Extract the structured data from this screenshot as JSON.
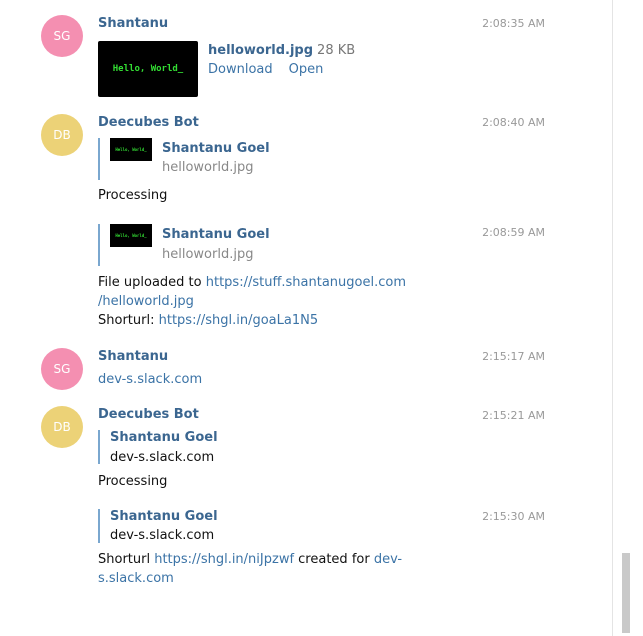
{
  "messages": {
    "m1": {
      "avatar": "SG",
      "author": "Shantanu",
      "time": "2:08:35 AM",
      "file": {
        "thumb_text": "Hello, World_",
        "name": "helloworld.jpg",
        "size": "28 KB",
        "download": "Download",
        "open": "Open"
      }
    },
    "m2": {
      "avatar": "DB",
      "author": "Deecubes Bot",
      "time": "2:08:40 AM",
      "quote": {
        "thumb_text": "Hello, World_",
        "title": "Shantanu Goel",
        "subtitle": "helloworld.jpg"
      },
      "text": "Processing"
    },
    "m3": {
      "time": "2:08:59 AM",
      "quote": {
        "thumb_text": "Hello, World_",
        "title": "Shantanu Goel",
        "subtitle": "helloworld.jpg"
      },
      "line1_prefix": "File uploaded to ",
      "line1_link": "https://stuff.shantanugoel.com",
      "line2_link": "/helloworld.jpg",
      "line3_prefix": "Shorturl: ",
      "line3_link": "https://shgl.in/goaLa1N5"
    },
    "m4": {
      "avatar": "SG",
      "author": "Shantanu",
      "time": "2:15:17 AM",
      "link": "dev-s.slack.com"
    },
    "m5": {
      "avatar": "DB",
      "author": "Deecubes Bot",
      "time": "2:15:21 AM",
      "quote": {
        "title": "Shantanu Goel",
        "body": "dev-s.slack.com"
      },
      "text": "Processing"
    },
    "m6": {
      "time": "2:15:30 AM",
      "quote": {
        "title": "Shantanu Goel",
        "body": "dev-s.slack.com"
      },
      "prefix": "Shorturl ",
      "link": "https://shgl.in/niJpzwf",
      "middle": " created for ",
      "link2a": "dev-",
      "link2b": "s.slack.com"
    }
  },
  "colors": {
    "avatar_sg": "#f48fb1",
    "avatar_db": "#ecd277",
    "name": "#3b6690",
    "link": "#3b73a6",
    "quote_bar": "#7aa7cf"
  }
}
